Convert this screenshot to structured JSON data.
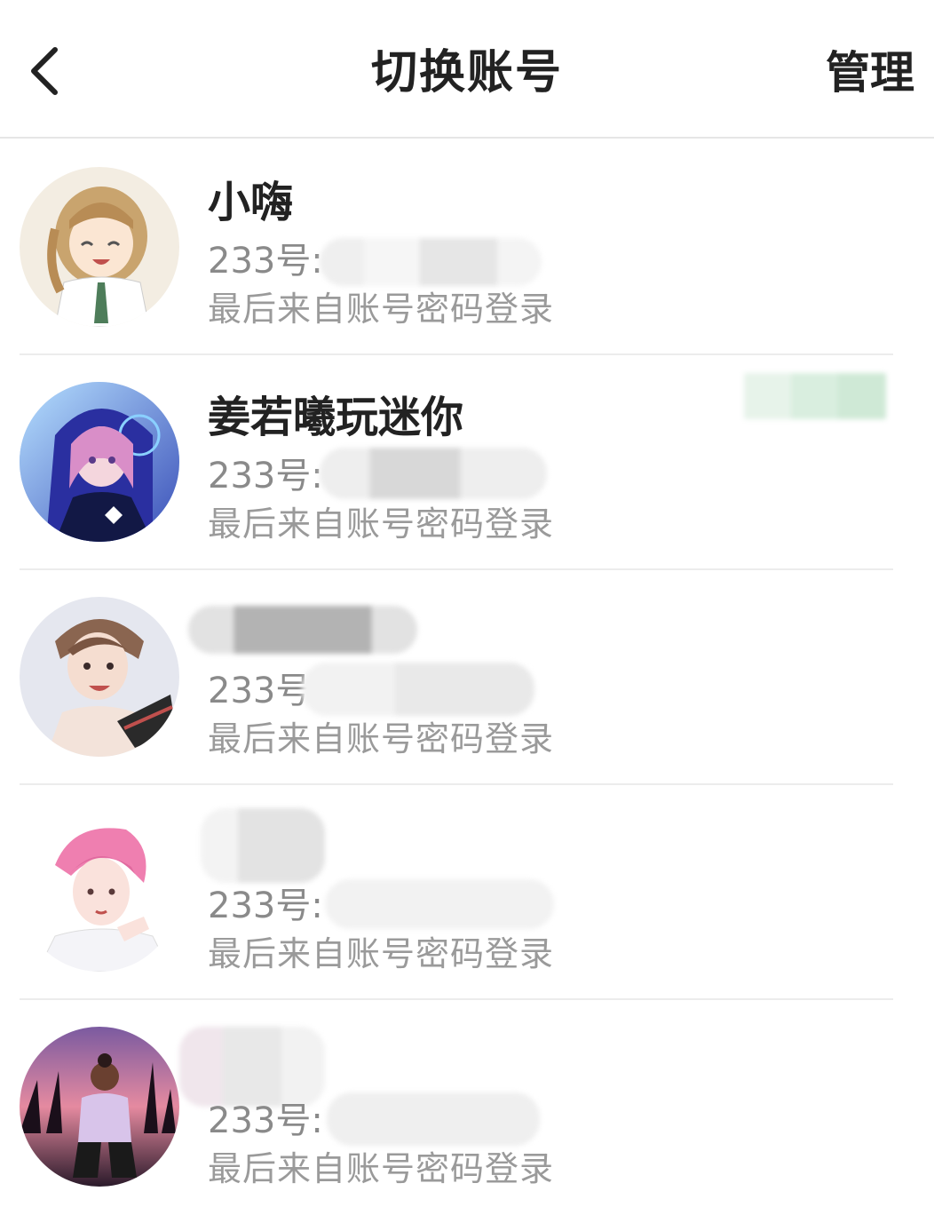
{
  "header": {
    "title": "切换账号",
    "manage_label": "管理"
  },
  "accounts": [
    {
      "name": "小嗨",
      "id_label": "233号:",
      "login_source": "最后来自账号密码登录",
      "avatar": "anime-girl-smiling-avatar"
    },
    {
      "name": "姜若曦玩迷你",
      "id_label": "233号:",
      "login_source": "最后来自账号密码登录",
      "avatar": "anime-girl-hoodie-avatar"
    },
    {
      "name": "",
      "id_label": "233号",
      "login_source": "最后来自账号密码登录",
      "avatar": "anime-boy-avatar"
    },
    {
      "name": "",
      "id_label": "233号:",
      "login_source": "最后来自账号密码登录",
      "avatar": "pink-hair-boy-avatar"
    },
    {
      "name": "",
      "id_label": "233号:",
      "login_source": "最后来自账号密码登录",
      "avatar": "sunset-girl-avatar"
    }
  ],
  "colors": {
    "title": "#222222",
    "secondary_text": "#8a8a8a",
    "divider": "#ececec",
    "accent_badge": "#cfe9d6"
  }
}
